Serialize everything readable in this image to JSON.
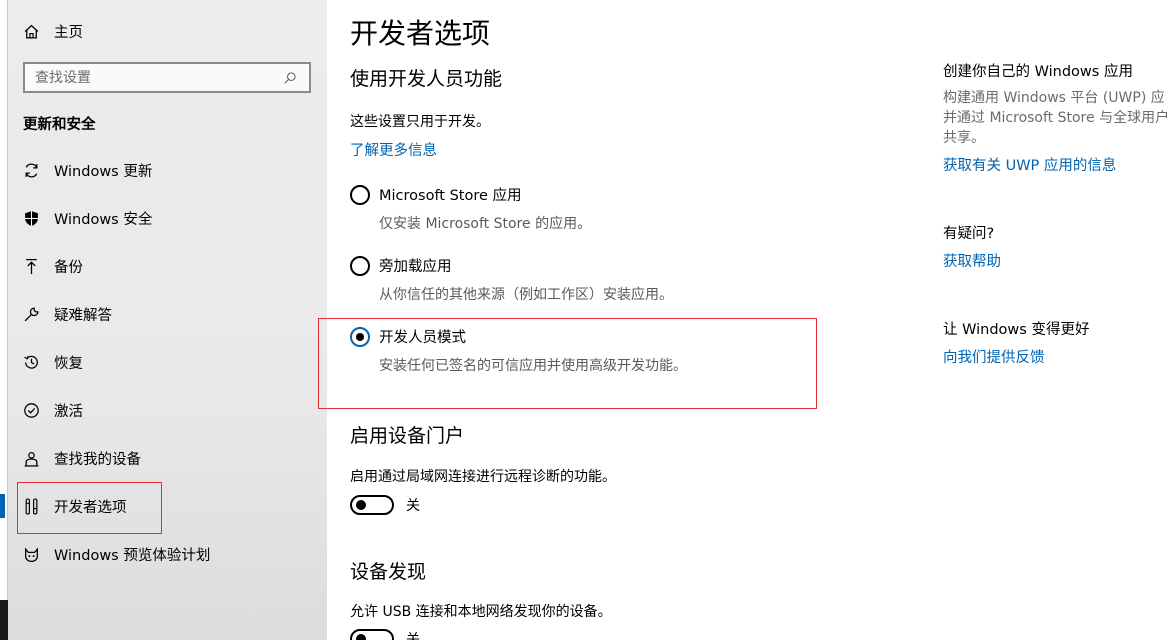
{
  "sidebar": {
    "home_label": "主页",
    "search_placeholder": "查找设置",
    "section_title": "更新和安全",
    "items": [
      {
        "label": "Windows 更新",
        "icon": "refresh-icon"
      },
      {
        "label": "Windows 安全",
        "icon": "shield-icon"
      },
      {
        "label": "备份",
        "icon": "backup-arrow-icon"
      },
      {
        "label": "疑难解答",
        "icon": "wrench-icon"
      },
      {
        "label": "恢复",
        "icon": "history-icon"
      },
      {
        "label": "激活",
        "icon": "check-circle-icon"
      },
      {
        "label": "查找我的设备",
        "icon": "person-location-icon"
      },
      {
        "label": "开发者选项",
        "icon": "developer-tools-icon",
        "selected": true
      },
      {
        "label": "Windows 预览体验计划",
        "icon": "insider-cat-icon"
      }
    ]
  },
  "main": {
    "title": "开发者选项",
    "section1": {
      "heading": "使用开发人员功能",
      "intro": "这些设置只用于开发。",
      "learn_more": "了解更多信息",
      "options": [
        {
          "label": "Microsoft Store 应用",
          "desc": "仅安装 Microsoft Store 的应用。",
          "checked": false
        },
        {
          "label": "旁加载应用",
          "desc": "从你信任的其他来源（例如工作区）安装应用。",
          "checked": false
        },
        {
          "label": "开发人员模式",
          "desc": "安装任何已签名的可信应用并使用高级开发功能。",
          "checked": true
        }
      ]
    },
    "section2": {
      "heading": "启用设备门户",
      "desc": "启用通过局域网连接进行远程诊断的功能。",
      "toggle_label": "关"
    },
    "section3": {
      "heading": "设备发现",
      "desc": "允许 USB 连接和本地网络发现你的设备。",
      "toggle_label": "关"
    }
  },
  "right": {
    "block1": {
      "heading": "创建你自己的 Windows 应用",
      "lines": [
        "构建通用 Windows 平台 (UWP) 应",
        "并通过 Microsoft Store 与全球用户",
        "共享。"
      ],
      "link": "获取有关 UWP 应用的信息"
    },
    "block2": {
      "heading": "有疑问?",
      "link": "获取帮助"
    },
    "block3": {
      "heading": "让 Windows 变得更好",
      "link": "向我们提供反馈"
    }
  },
  "colors": {
    "accent": "#0063b1",
    "annotation_red": "#e03030",
    "sidebar_bg": "#ececec"
  }
}
